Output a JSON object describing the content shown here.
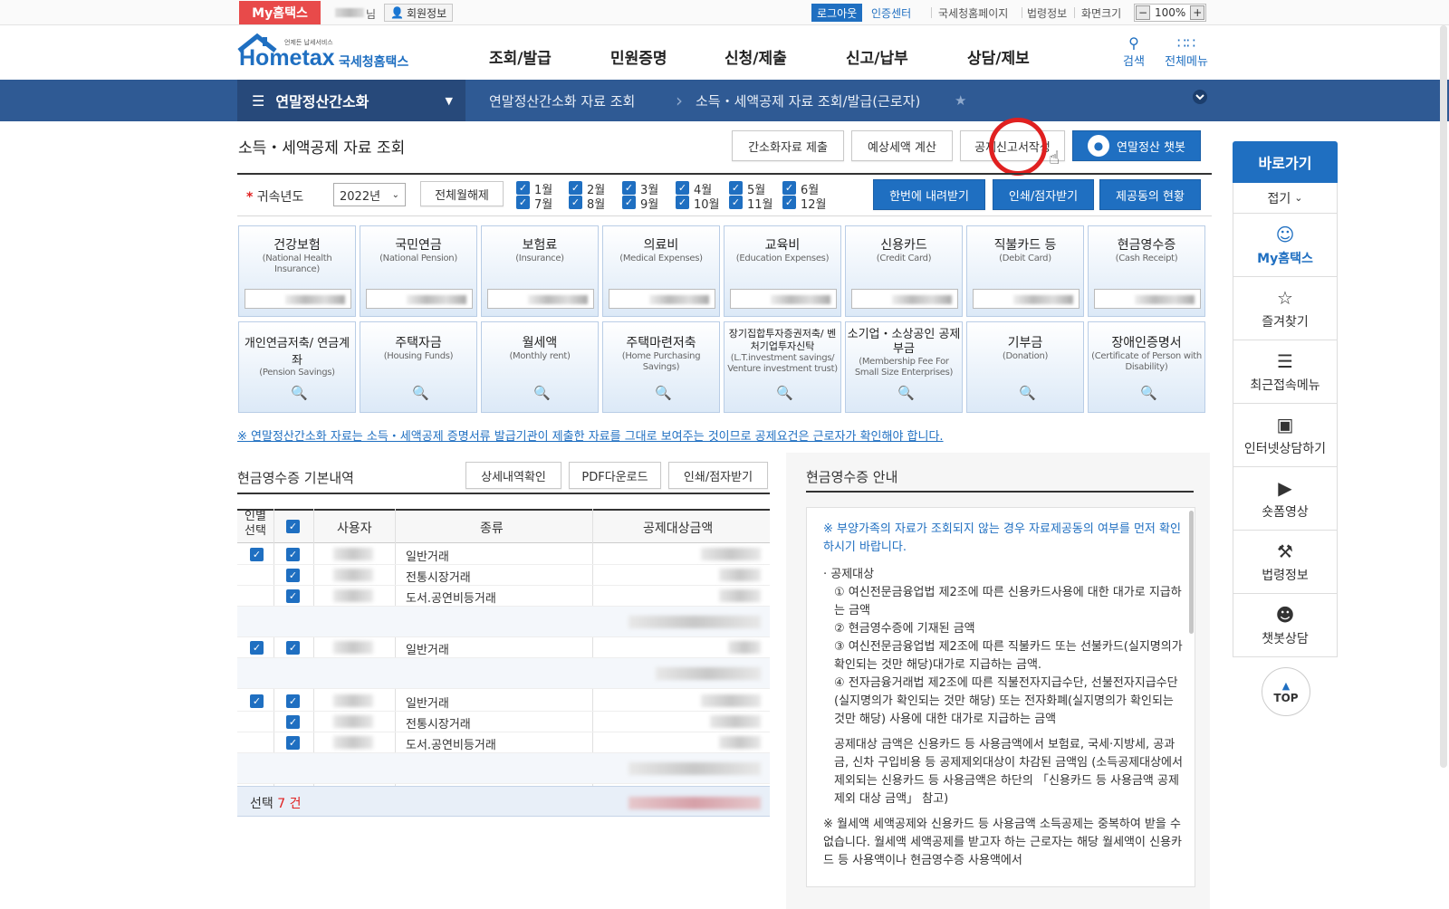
{
  "utility": {
    "brand": "My홈택스",
    "nim": "님",
    "member_info": "회원정보",
    "logout": "로그아웃",
    "cert_center": "인증센터",
    "nts_home": "국세청홈페이지",
    "law_info": "법령정보",
    "screen_size": "화면크기",
    "zoom": "100%"
  },
  "header": {
    "logo_text": "Hometax",
    "logo_sub": "국세청홈택스",
    "logo_tag": "언제든 납세서비스",
    "nav": [
      "조회/발급",
      "민원증명",
      "신청/제출",
      "신고/납부",
      "상담/제보"
    ],
    "search": "검색",
    "all_menu": "전체메뉴"
  },
  "location": {
    "current": "연말정산간소화",
    "crumb1": "연말정산간소화 자료 조회",
    "crumb2": "소득・세액공제 자료 조회/발급(근로자)"
  },
  "page": {
    "title": "소득・세액공제 자료 조회",
    "btn_simple_submit": "간소화자료 제출",
    "btn_estimate": "예상세액 계산",
    "btn_deduction_report": "공제신고서작성",
    "btn_chatbot": "연말정산 챗봇"
  },
  "filter": {
    "year_label": "귀속년도",
    "year_required_mark": "*",
    "year_value": "2022년",
    "btn_clear_months": "전체월해제",
    "months": [
      "1월",
      "2월",
      "3월",
      "4월",
      "5월",
      "6월",
      "7월",
      "8월",
      "9월",
      "10월",
      "11월",
      "12월"
    ],
    "btn_download_all": "한번에 내려받기",
    "btn_print": "인쇄/점자받기",
    "btn_consent": "제공동의 현황"
  },
  "cards_row1": [
    {
      "title": "건강보험",
      "sub": "(National Health Insurance)"
    },
    {
      "title": "국민연금",
      "sub": "(National Pension)"
    },
    {
      "title": "보험료",
      "sub": "(Insurance)"
    },
    {
      "title": "의료비",
      "sub": "(Medical Expenses)"
    },
    {
      "title": "교육비",
      "sub": "(Education Expenses)"
    },
    {
      "title": "신용카드",
      "sub": "(Credit Card)"
    },
    {
      "title": "직불카드 등",
      "sub": "(Debit Card)"
    },
    {
      "title": "현금영수증",
      "sub": "(Cash Receipt)"
    }
  ],
  "cards_row2": [
    {
      "title": "개인연금저축/ 연금계좌",
      "sub": "(Pension Savings)"
    },
    {
      "title": "주택자금",
      "sub": "(Housing Funds)"
    },
    {
      "title": "월세액",
      "sub": "(Monthly rent)"
    },
    {
      "title": "주택마련저축",
      "sub": "(Home Purchasing Savings)"
    },
    {
      "title": "장기집합투자증권저축/ 벤처기업투자신탁",
      "sub": "(L.T.investment savings/ Venture investment trust)"
    },
    {
      "title": "소기업・소상공인 공제부금",
      "sub": "(Membership Fee For Small Size Enterprises)"
    },
    {
      "title": "기부금",
      "sub": "(Donation)"
    },
    {
      "title": "장애인증명서",
      "sub": "(Certificate of Person with Disability)"
    }
  ],
  "notice": "※ 연말정산간소화 자료는 소득・세액공제 증명서류 발급기관이 제출한 자료를 그대로 보여주는 것이므로 공제요건은 근로자가 확인해야 합니다.",
  "table": {
    "title": "현금영수증 기본내역",
    "btn_detail": "상세내역확인",
    "btn_pdf": "PDF다운로드",
    "btn_print": "인쇄/점자받기",
    "col_person": "인별 선택",
    "col_user": "사용자",
    "col_type": "종류",
    "col_amount": "공제대상금액",
    "rows": [
      {
        "type": "일반거래"
      },
      {
        "type": "전통시장거래"
      },
      {
        "type": "도서.공연비등거래"
      },
      {
        "type": "일반거래"
      },
      {
        "type": "일반거래"
      },
      {
        "type": "전통시장거래"
      },
      {
        "type": "도서.공연비등거래"
      }
    ],
    "footer_label": "선택",
    "footer_count": "7 건"
  },
  "guide": {
    "title": "현금영수증 안내",
    "note": "※ 부양가족의 자료가 조회되지 않는 경우 자료제공동의 여부를 먼저 확인하시기 바랍니다.",
    "target_title": "공제대상",
    "item1": "① 여신전문금융업법 제2조에 따른 신용카드사용에 대한 대가로 지급하는 금액",
    "item2": "② 현금영수증에 기재된 금액",
    "item3": "③ 여신전문금융업법 제2조에 따른 직불카드 또는 선불카드(실지명의가 확인되는 것만 해당)대가로 지급하는 금액.",
    "item4": "④ 전자금융거래법 제2조에 따른 직불전자지급수단, 선불전자지급수단(실지명의가 확인되는 것만 해당) 또는 전자화폐(실지명의가 확인되는 것만 해당) 사용에 대한 대가로 지급하는 금액",
    "amount_note": "공제대상 금액은 신용카드 등 사용금액에서 보험료, 국세·지방세, 공과금, 신차 구입비용 등 공제제외대상이 차감된 금액임 (소득공제대상에서 제외되는 신용카드 등 사용금액은 하단의 「신용카드 등 사용금액 공제제외 대상 금액」 참고)",
    "rent_note": "※ 월세액 세액공제와 신용카드 등 사용금액 소득공제는 중복하여 받을 수 없습니다. 월세액 세액공제를 받고자 하는 근로자는 해당 월세액이 신용카드 등 사용액이나 현금영수증 사용액에서"
  },
  "quick": {
    "title": "바로가기",
    "fold": "접기",
    "items": [
      {
        "label": "My홈택스",
        "icon": "person-icon"
      },
      {
        "label": "즐겨찾기",
        "icon": "star-icon"
      },
      {
        "label": "최근접속메뉴",
        "icon": "recent-icon"
      },
      {
        "label": "인터넷상담하기",
        "icon": "monitor-icon"
      },
      {
        "label": "숏폼영상",
        "icon": "play-icon"
      },
      {
        "label": "법령정보",
        "icon": "gavel-icon"
      },
      {
        "label": "챗봇상담",
        "icon": "chatbot-icon"
      }
    ],
    "top": "TOP"
  },
  "colors": {
    "primary": "#1f6fc1",
    "location_bar": "#2f5a94",
    "brand_red": "#e84a4a",
    "highlight_circle": "#e02020"
  }
}
